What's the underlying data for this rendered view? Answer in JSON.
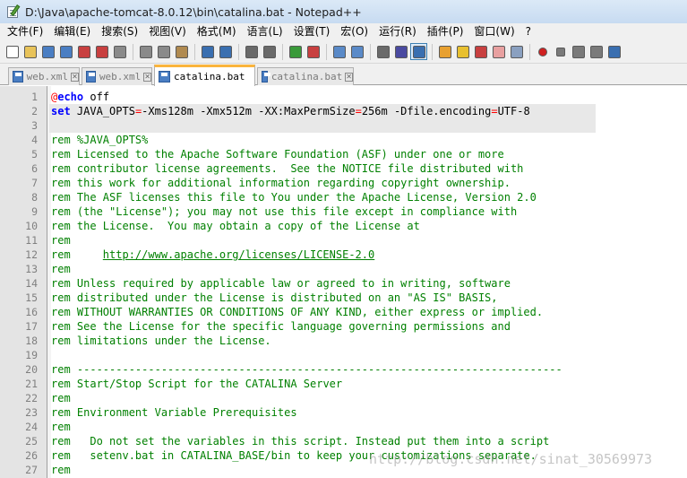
{
  "window": {
    "title": "D:\\Java\\apache-tomcat-8.0.12\\bin\\catalina.bat - Notepad++"
  },
  "menu": [
    "文件(F)",
    "编辑(E)",
    "搜索(S)",
    "视图(V)",
    "格式(M)",
    "语言(L)",
    "设置(T)",
    "宏(O)",
    "运行(R)",
    "插件(P)",
    "窗口(W)",
    "?"
  ],
  "toolbar": {
    "icons": [
      "new-file-icon",
      "open-file-icon",
      "save-icon",
      "save-all-icon",
      "close-icon",
      "close-all-icon",
      "print-icon",
      "cut-icon",
      "copy-icon",
      "paste-icon",
      "undo-icon",
      "redo-icon",
      "find-icon",
      "replace-icon",
      "zoom-in-icon",
      "zoom-out-icon",
      "sync-v-icon",
      "sync-h-icon",
      "word-wrap-icon",
      "show-all-chars-icon",
      "indent-guide-icon",
      "lang-icon",
      "doc-map-icon",
      "function-list-icon",
      "folder-workspace-icon",
      "monitoring-icon",
      "record-macro-icon",
      "stop-macro-icon",
      "play-macro-icon",
      "run-macro-icon",
      "save-macro-icon"
    ]
  },
  "tabs": [
    {
      "label": "web.xml",
      "active": false,
      "color": "blue"
    },
    {
      "label": "web.xml",
      "active": false,
      "color": "blue"
    },
    {
      "label": "catalina.bat",
      "active": true,
      "color": "blue"
    },
    {
      "label": "catalina.bat",
      "active": false,
      "color": "blue"
    }
  ],
  "editor": {
    "lines": [
      {
        "n": "1",
        "parts": [
          [
            "at",
            "@"
          ],
          [
            "kw",
            "echo"
          ],
          [
            "plain",
            " off"
          ]
        ]
      },
      {
        "n": "2",
        "hl": true,
        "parts": [
          [
            "kw",
            "set"
          ],
          [
            "plain",
            " JAVA_OPTS"
          ],
          [
            "op",
            "="
          ],
          [
            "plain",
            "-Xms128m -Xmx512m -XX:MaxPermSize"
          ],
          [
            "op",
            "="
          ],
          [
            "plain",
            "256m -Dfile.encoding"
          ],
          [
            "op",
            "="
          ],
          [
            "plain",
            "UTF-8"
          ]
        ]
      },
      {
        "n": "3",
        "hl2": true,
        "parts": [
          [
            "plain",
            "  "
          ]
        ]
      },
      {
        "n": "4",
        "parts": [
          [
            "rem",
            "rem %JAVA_OPTS%"
          ]
        ]
      },
      {
        "n": "5",
        "parts": [
          [
            "rem",
            "rem "
          ],
          [
            "plain",
            "Licensed to the Apache Software Foundation (ASF) under one or more"
          ]
        ]
      },
      {
        "n": "6",
        "parts": [
          [
            "rem",
            "rem "
          ],
          [
            "plain",
            "contributor license agreements.  See the NOTICE file distributed with"
          ]
        ]
      },
      {
        "n": "7",
        "parts": [
          [
            "rem",
            "rem "
          ],
          [
            "plain",
            "this work for additional information regarding copyright ownership."
          ]
        ]
      },
      {
        "n": "8",
        "parts": [
          [
            "rem",
            "rem "
          ],
          [
            "plain",
            "The ASF licenses this file to You under the Apache License, Version 2.0"
          ]
        ]
      },
      {
        "n": "9",
        "parts": [
          [
            "rem",
            "rem "
          ],
          [
            "plain",
            "(the \"License\"); you may not use this file except in compliance with"
          ]
        ]
      },
      {
        "n": "10",
        "parts": [
          [
            "rem",
            "rem "
          ],
          [
            "plain",
            "the License.  You may obtain a copy of the License at"
          ]
        ]
      },
      {
        "n": "11",
        "parts": [
          [
            "rem",
            "rem"
          ]
        ]
      },
      {
        "n": "12",
        "parts": [
          [
            "rem",
            "rem     "
          ],
          [
            "url",
            "http://www.apache.org/licenses/LICENSE-2.0"
          ]
        ]
      },
      {
        "n": "13",
        "parts": [
          [
            "rem",
            "rem"
          ]
        ]
      },
      {
        "n": "14",
        "parts": [
          [
            "rem",
            "rem "
          ],
          [
            "plain",
            "Unless required by applicable law or agreed to in writing, software"
          ]
        ]
      },
      {
        "n": "15",
        "parts": [
          [
            "rem",
            "rem "
          ],
          [
            "plain",
            "distributed under the License is distributed on an \"AS IS\" BASIS,"
          ]
        ]
      },
      {
        "n": "16",
        "parts": [
          [
            "rem",
            "rem "
          ],
          [
            "plain",
            "WITHOUT WARRANTIES OR CONDITIONS OF ANY KIND, either express or implied."
          ]
        ]
      },
      {
        "n": "17",
        "parts": [
          [
            "rem",
            "rem "
          ],
          [
            "plain",
            "See the License for the specific language governing permissions and"
          ]
        ]
      },
      {
        "n": "18",
        "parts": [
          [
            "rem",
            "rem "
          ],
          [
            "plain",
            "limitations under the License."
          ]
        ]
      },
      {
        "n": "19",
        "parts": [
          [
            "plain",
            ""
          ]
        ]
      },
      {
        "n": "20",
        "parts": [
          [
            "rem",
            "rem "
          ],
          [
            "plain",
            "---------------------------------------------------------------------------"
          ]
        ]
      },
      {
        "n": "21",
        "parts": [
          [
            "rem",
            "rem "
          ],
          [
            "plain",
            "Start/Stop Script for the CATALINA Server"
          ]
        ]
      },
      {
        "n": "22",
        "parts": [
          [
            "rem",
            "rem"
          ]
        ]
      },
      {
        "n": "23",
        "parts": [
          [
            "rem",
            "rem "
          ],
          [
            "plain",
            "Environment Variable Prerequisites"
          ]
        ]
      },
      {
        "n": "24",
        "parts": [
          [
            "rem",
            "rem"
          ]
        ]
      },
      {
        "n": "25",
        "parts": [
          [
            "rem",
            "rem   "
          ],
          [
            "plain",
            "Do not set the variables in this script. Instead put them into a script"
          ]
        ]
      },
      {
        "n": "26",
        "parts": [
          [
            "rem",
            "rem   "
          ],
          [
            "plain",
            "setenv.bat in CATALINA_BASE/bin to keep your customizations separate."
          ]
        ]
      },
      {
        "n": "27",
        "parts": [
          [
            "rem",
            "rem"
          ]
        ]
      }
    ]
  },
  "watermark": "http://blog.csdn.net/sinat_30569973",
  "colors": {
    "keyword": "#0000ff",
    "operator": "#ff0000",
    "comment": "#008000",
    "active_tab_accent": "#fab43c"
  }
}
